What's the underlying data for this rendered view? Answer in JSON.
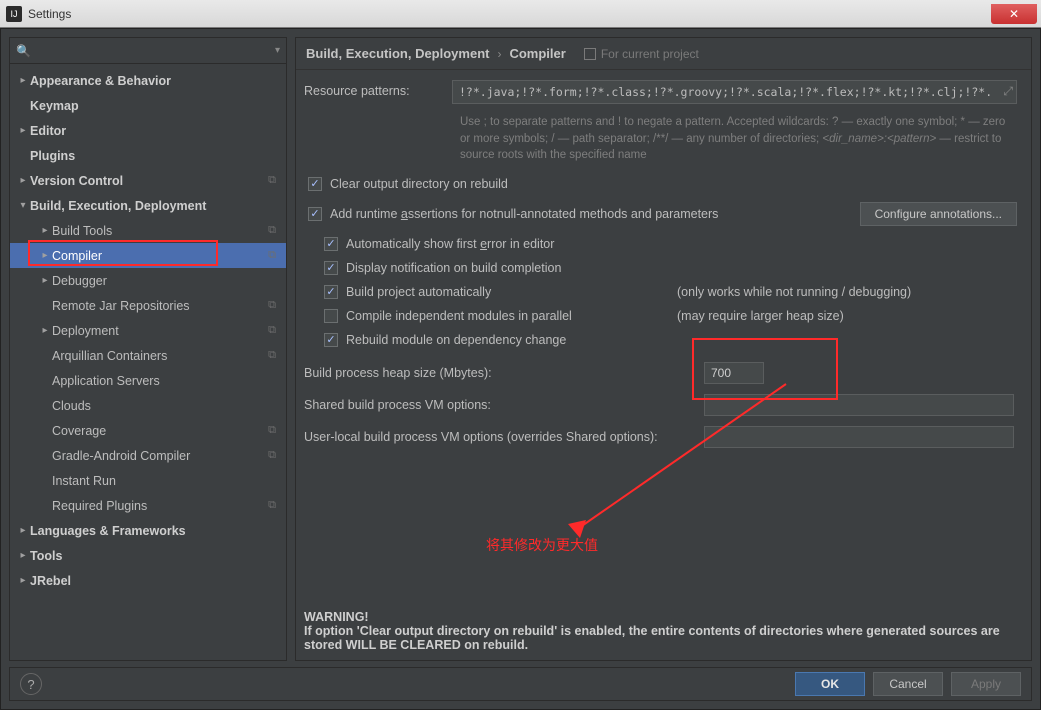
{
  "title": "Settings",
  "sidebar": {
    "search_placeholder": "",
    "items": [
      {
        "label": "Appearance & Behavior",
        "bold": true,
        "arrow": "right",
        "indent": 0,
        "rc": false
      },
      {
        "label": "Keymap",
        "bold": true,
        "arrow": "none",
        "indent": 0,
        "rc": false
      },
      {
        "label": "Editor",
        "bold": true,
        "arrow": "right",
        "indent": 0,
        "rc": false
      },
      {
        "label": "Plugins",
        "bold": true,
        "arrow": "none",
        "indent": 0,
        "rc": false
      },
      {
        "label": "Version Control",
        "bold": true,
        "arrow": "right",
        "indent": 0,
        "rc": true
      },
      {
        "label": "Build, Execution, Deployment",
        "bold": true,
        "arrow": "down",
        "indent": 0,
        "rc": false
      },
      {
        "label": "Build Tools",
        "bold": false,
        "arrow": "right",
        "indent": 1,
        "rc": true
      },
      {
        "label": "Compiler",
        "bold": false,
        "arrow": "right",
        "indent": 1,
        "rc": true,
        "selected": true
      },
      {
        "label": "Debugger",
        "bold": false,
        "arrow": "right",
        "indent": 1,
        "rc": false
      },
      {
        "label": "Remote Jar Repositories",
        "bold": false,
        "arrow": "none",
        "indent": 1,
        "rc": true
      },
      {
        "label": "Deployment",
        "bold": false,
        "arrow": "right",
        "indent": 1,
        "rc": true
      },
      {
        "label": "Arquillian Containers",
        "bold": false,
        "arrow": "none",
        "indent": 1,
        "rc": true
      },
      {
        "label": "Application Servers",
        "bold": false,
        "arrow": "none",
        "indent": 1,
        "rc": false
      },
      {
        "label": "Clouds",
        "bold": false,
        "arrow": "none",
        "indent": 1,
        "rc": false
      },
      {
        "label": "Coverage",
        "bold": false,
        "arrow": "none",
        "indent": 1,
        "rc": true
      },
      {
        "label": "Gradle-Android Compiler",
        "bold": false,
        "arrow": "none",
        "indent": 1,
        "rc": true
      },
      {
        "label": "Instant Run",
        "bold": false,
        "arrow": "none",
        "indent": 1,
        "rc": false
      },
      {
        "label": "Required Plugins",
        "bold": false,
        "arrow": "none",
        "indent": 1,
        "rc": true
      },
      {
        "label": "Languages & Frameworks",
        "bold": true,
        "arrow": "right",
        "indent": 0,
        "rc": false
      },
      {
        "label": "Tools",
        "bold": true,
        "arrow": "right",
        "indent": 0,
        "rc": false
      },
      {
        "label": "JRebel",
        "bold": true,
        "arrow": "right",
        "indent": 0,
        "rc": false
      }
    ]
  },
  "breadcrumb": {
    "a": "Build, Execution, Deployment",
    "b": "Compiler",
    "proj": "For current project"
  },
  "resource": {
    "label": "Resource patterns:",
    "value": "!?*.java;!?*.form;!?*.class;!?*.groovy;!?*.scala;!?*.flex;!?*.kt;!?*.clj;!?*.aj",
    "hint_a": "Use ; to separate patterns and ! to negate a pattern. Accepted wildcards: ? — exactly one symbol; * — zero or more symbols; / — path separator; /**/ — any number of directories; ",
    "hint_b": "<dir_name>:<pattern>",
    "hint_c": " — restrict to source roots with the specified name"
  },
  "checks": {
    "clear": "Clear output directory on rebuild",
    "assert_a": "Add runtime ",
    "assert_u": "a",
    "assert_b": "ssertions for notnull-annotated methods and parameters",
    "configure": "Configure annotations...",
    "auto_err_a": "Automatically show first ",
    "auto_err_u": "e",
    "auto_err_b": "rror in editor",
    "notify": "Display notification on build completion",
    "build_auto": "Build project automatically",
    "build_auto_aux": "(only works while not running / debugging)",
    "parallel": "Compile independent modules in parallel",
    "parallel_aux": "(may require larger heap size)",
    "rebuild_dep": "Rebuild module on dependency change"
  },
  "form": {
    "heap_label": "Build process heap size (Mbytes):",
    "heap_value": "700",
    "shared_label": "Shared build process VM options:",
    "shared_value": "",
    "user_label": "User-local build process VM options (overrides Shared options):",
    "user_value": ""
  },
  "warning": {
    "h": "WARNING!",
    "t1": "If option '",
    "b": "Clear output directory on rebuild",
    "t2": "' is enabled, the entire contents of directories where generated sources are stored WILL BE CLEARED on rebuild."
  },
  "buttons": {
    "ok": "OK",
    "cancel": "Cancel",
    "apply": "Apply"
  },
  "annotation_text": "将其修改为更大值"
}
